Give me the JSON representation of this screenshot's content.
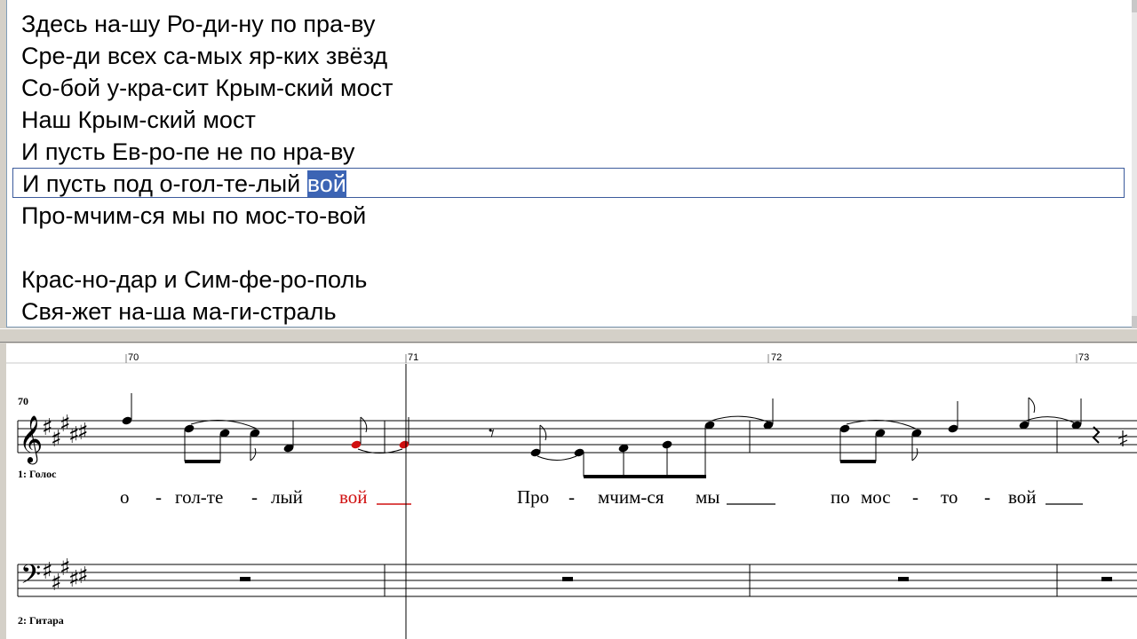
{
  "lyrics": {
    "lines": [
      "Здесь на-шу Ро-ди-ну по пра-ву",
      "Сре-ди всех са-мых яр-ких звёзд",
      "Со-бой у-кра-сит Крым-ский мост",
      "Наш Крым-ский мост",
      "И пусть Ев-ро-пе не по нра-ву",
      "И пусть под о-гол-те-лый ",
      "Про-мчим-ся мы по мос-то-вой",
      "",
      "Крас-но-дар и Сим-фе-ро-поль",
      "Свя-жет на-ша ма-ги-страль"
    ],
    "current_line_index": 5,
    "selected_syllable": "вой"
  },
  "score": {
    "ruler": [
      "70",
      "71",
      "72",
      "73"
    ],
    "measure_number": "70",
    "tracks": [
      "1: Голос",
      "2: Гитара"
    ],
    "syllables": [
      "о",
      "гол-те",
      "лый",
      "вой",
      "Про",
      "мчим-ся",
      "мы",
      "по",
      "мос",
      "то",
      "вой"
    ],
    "highlight_color": "#d01010",
    "clefs": {
      "treble": "𝄞",
      "bass": "𝄢"
    },
    "sharp_glyph": "♯",
    "rest_glyph": "𝄾"
  }
}
